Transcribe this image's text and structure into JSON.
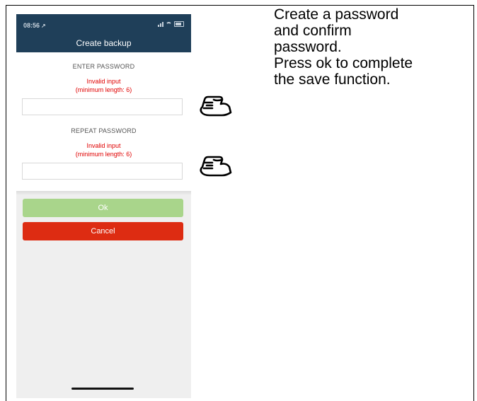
{
  "status_bar": {
    "time": "08:56",
    "location_arrow": "↗"
  },
  "header": {
    "title": "Create backup"
  },
  "fields": [
    {
      "label": "ENTER PASSWORD",
      "error_line1": "Invalid input",
      "error_line2": "(minimum length: 6)",
      "value": ""
    },
    {
      "label": "REPEAT PASSWORD",
      "error_line1": "Invalid input",
      "error_line2": "(minimum length: 6)",
      "value": ""
    }
  ],
  "buttons": {
    "ok": "Ok",
    "cancel": "Cancel"
  },
  "colors": {
    "header_bg": "#1f3f59",
    "error": "#e00000",
    "ok_bg": "#a9d58b",
    "cancel_bg": "#dd2c12"
  },
  "icons": {
    "pointer": "pointing-hand-icon"
  },
  "instructions": {
    "lines": [
      "Create a password",
      "and confirm",
      "password.",
      "Press ok to complete",
      "the save function."
    ]
  }
}
